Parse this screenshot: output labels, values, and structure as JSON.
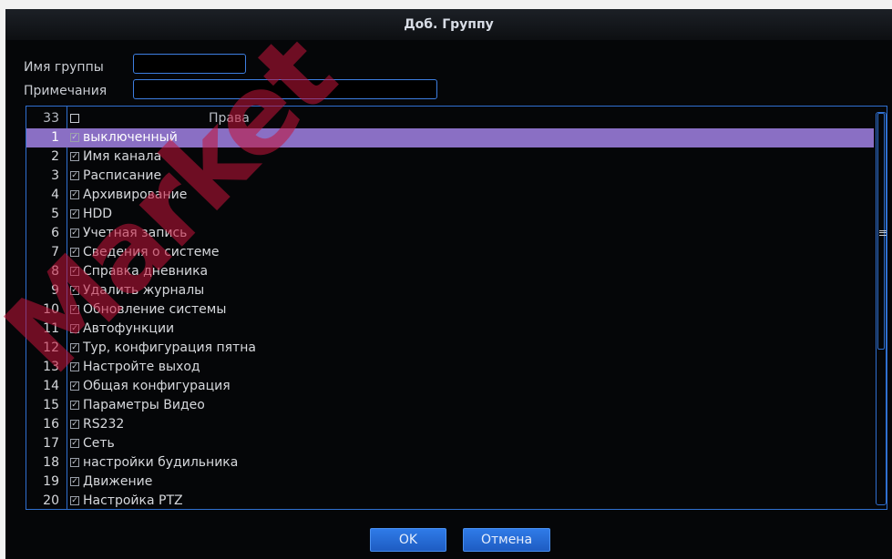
{
  "dialog": {
    "title": "Доб. Группу",
    "group_name_label": "Имя группы",
    "group_name_value": "",
    "notes_label": "Примечания",
    "notes_value": ""
  },
  "rights_list": {
    "header": {
      "count": "33",
      "column": "Права"
    },
    "selected_index": 0,
    "rows": [
      {
        "num": "1",
        "label": "выключенный"
      },
      {
        "num": "2",
        "label": "Имя канала"
      },
      {
        "num": "3",
        "label": "Расписание"
      },
      {
        "num": "4",
        "label": "Архивирование"
      },
      {
        "num": "5",
        "label": "HDD"
      },
      {
        "num": "6",
        "label": "Учетная запись"
      },
      {
        "num": "7",
        "label": "Сведения о системе"
      },
      {
        "num": "8",
        "label": "Справка дневника"
      },
      {
        "num": "9",
        "label": "Удалить журналы"
      },
      {
        "num": "10",
        "label": "Обновление системы"
      },
      {
        "num": "11",
        "label": "Автофункции"
      },
      {
        "num": "12",
        "label": "Тур, конфигурация пятна"
      },
      {
        "num": "13",
        "label": "Настройте выход"
      },
      {
        "num": "14",
        "label": "Общая конфигурация"
      },
      {
        "num": "15",
        "label": "Параметры Видео"
      },
      {
        "num": "16",
        "label": "RS232"
      },
      {
        "num": "17",
        "label": "Сеть"
      },
      {
        "num": "18",
        "label": "настройки будильника"
      },
      {
        "num": "19",
        "label": "Движение"
      },
      {
        "num": "20",
        "label": "Настройка PTZ"
      }
    ]
  },
  "buttons": {
    "ok": "OK",
    "cancel": "Отмена"
  },
  "watermark": "Market",
  "colors": {
    "accent": "#2f6fd0",
    "selection": "#8a6fc4",
    "button": "#2f7be8",
    "watermark": "#c4143a"
  },
  "icons": {
    "checkbox": "checkbox-icon",
    "scroll_grip": "scroll-grip-icon"
  }
}
